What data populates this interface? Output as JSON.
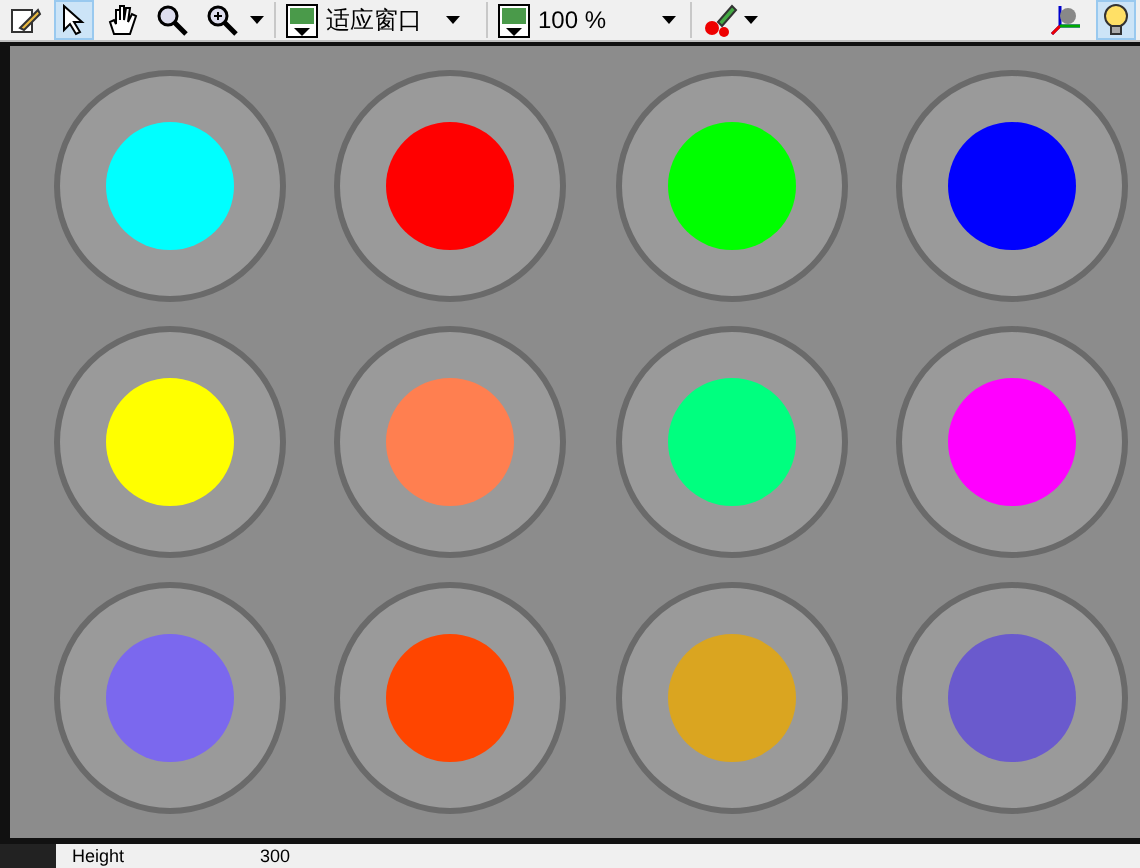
{
  "toolbar": {
    "tools": [
      {
        "kind": "edit",
        "selected": false
      },
      {
        "kind": "pointer",
        "selected": true
      },
      {
        "kind": "hand",
        "selected": false
      },
      {
        "kind": "search",
        "selected": false
      },
      {
        "kind": "zoomin",
        "selected": false
      }
    ],
    "fit_dropdown": {
      "value": "适应窗口"
    },
    "zoom_dropdown": {
      "value": "100 %"
    },
    "right_tools": [
      {
        "kind": "axes",
        "selected": false
      },
      {
        "kind": "bulb",
        "selected": true
      }
    ]
  },
  "wells": [
    {
      "color": "#00ffff"
    },
    {
      "color": "#ff0000"
    },
    {
      "color": "#00ff00"
    },
    {
      "color": "#0000ff"
    },
    {
      "color": "#ffff00"
    },
    {
      "color": "#ff7f50"
    },
    {
      "color": "#00ff7f"
    },
    {
      "color": "#ff00ff"
    },
    {
      "color": "#7b68ee"
    },
    {
      "color": "#ff4500"
    },
    {
      "color": "#daa520"
    },
    {
      "color": "#6a5acd"
    }
  ],
  "status_bar": {
    "label": "Height",
    "value": "300"
  }
}
